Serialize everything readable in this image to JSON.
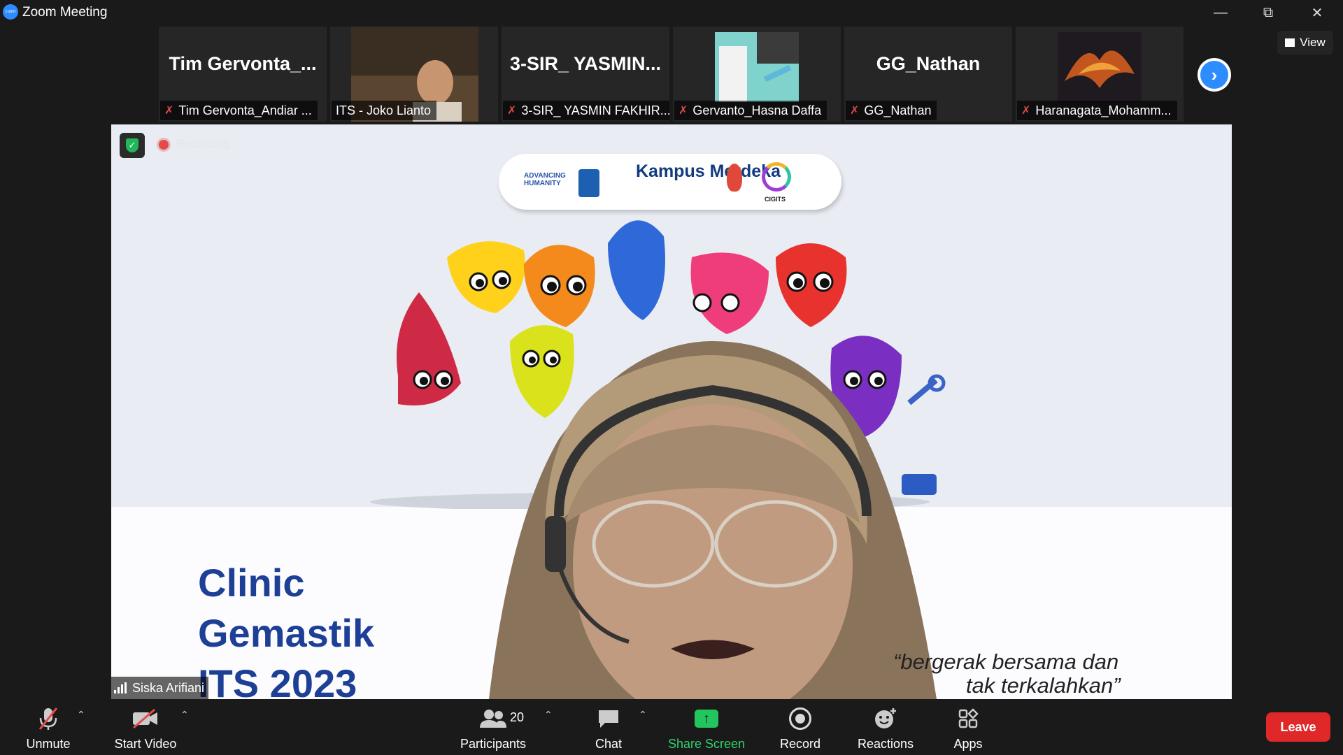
{
  "window": {
    "title": "Zoom Meeting",
    "logo_text": "zoom"
  },
  "participants_strip": [
    {
      "big_name": "Tim  Gervonta_...",
      "name": "Tim Gervonta_Andiar ...",
      "muted": true
    },
    {
      "big_name": "",
      "name": "ITS - Joko Lianto",
      "muted": false
    },
    {
      "big_name": "3-SIR_  YASMIN...",
      "name": "3-SIR_ YASMIN FAKHIR...",
      "muted": true
    },
    {
      "big_name": "",
      "name": "Gervanto_Hasna Daffa",
      "muted": true
    },
    {
      "big_name": "GG_Nathan",
      "name": "GG_Nathan",
      "muted": true
    },
    {
      "big_name": "",
      "name": "Haranagata_Mohamm...",
      "muted": true
    }
  ],
  "view_button": {
    "label": "View"
  },
  "main": {
    "recording_label": "Recording",
    "speaker_name": "Siska Arifiani",
    "slide": {
      "logo_text_1": "ADVANCING HUMANITY",
      "logo_text_2": "Kampus Merdeka",
      "logo_text_3": "CIGITS",
      "title_lines": [
        "Clinic",
        "Gemastik",
        "ITS 2023"
      ],
      "quote_line_1": "“bergerak bersama dan",
      "quote_line_2": "tak terkalahkan”"
    }
  },
  "toolbar": {
    "unmute": "Unmute",
    "start_video": "Start Video",
    "participants": "Participants",
    "participants_count": "20",
    "chat": "Chat",
    "share_screen": "Share Screen",
    "record": "Record",
    "reactions": "Reactions",
    "apps": "Apps",
    "leave": "Leave"
  },
  "colors": {
    "accent": "#2d8cff",
    "share": "#22c55e",
    "leave": "#e02828",
    "muted": "#e24b4b"
  }
}
